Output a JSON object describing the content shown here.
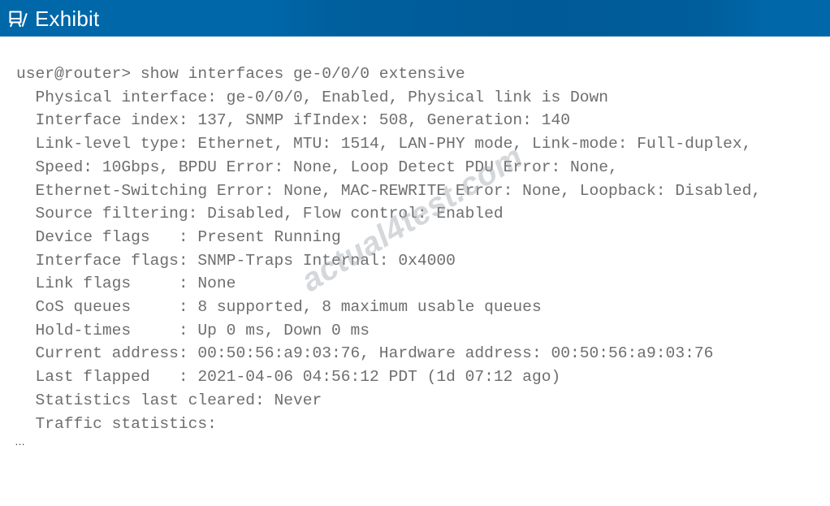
{
  "header": {
    "title": "Exhibit",
    "icon": "exhibit-easel-icon",
    "background_color": "#0067a8",
    "text_color": "#ffffff"
  },
  "terminal": {
    "prompt": "user@router>",
    "command": "show interfaces ge-0/0/0 extensive",
    "text_color": "#6e6e6e",
    "background_color": "#ffffff",
    "ellipsis": "…",
    "lines": [
      "user@router> show interfaces ge-0/0/0 extensive",
      "  Physical interface: ge-0/0/0, Enabled, Physical link is Down",
      "  Interface index: 137, SNMP ifIndex: 508, Generation: 140",
      "  Link-level type: Ethernet, MTU: 1514, LAN-PHY mode, Link-mode: Full-duplex,",
      "  Speed: 10Gbps, BPDU Error: None, Loop Detect PDU Error: None,",
      "  Ethernet-Switching Error: None, MAC-REWRITE Error: None, Loopback: Disabled,",
      "  Source filtering: Disabled, Flow control: Enabled",
      "  Device flags   : Present Running",
      "  Interface flags: SNMP-Traps Internal: 0x4000",
      "  Link flags     : None",
      "  CoS queues     : 8 supported, 8 maximum usable queues",
      "  Hold-times     : Up 0 ms, Down 0 ms",
      "  Current address: 00:50:56:a9:03:76, Hardware address: 00:50:56:a9:03:76",
      "  Last flapped   : 2021-04-06 04:56:12 PDT (1d 07:12 ago)",
      "  Statistics last cleared: Never",
      "  Traffic statistics:"
    ],
    "fields": {
      "physical_interface": "ge-0/0/0",
      "admin_state": "Enabled",
      "physical_link": "Down",
      "interface_index": "137",
      "snmp_ifindex": "508",
      "generation": "140",
      "link_level_type": "Ethernet",
      "mtu": "1514",
      "phy_mode": "LAN-PHY mode",
      "link_mode": "Full-duplex",
      "speed": "10Gbps",
      "bpdu_error": "None",
      "loop_detect_pdu_error": "None",
      "ethernet_switching_error": "None",
      "mac_rewrite_error": "None",
      "loopback": "Disabled",
      "source_filtering": "Disabled",
      "flow_control": "Enabled",
      "device_flags": "Present Running",
      "interface_flags": "SNMP-Traps Internal: 0x4000",
      "link_flags": "None",
      "cos_queues": "8 supported, 8 maximum usable queues",
      "hold_times": "Up 0 ms, Down 0 ms",
      "current_address": "00:50:56:a9:03:76",
      "hardware_address": "00:50:56:a9:03:76",
      "last_flapped": "2021-04-06 04:56:12 PDT (1d 07:12 ago)",
      "statistics_last_cleared": "Never",
      "traffic_statistics": ""
    }
  },
  "watermark": {
    "text": "actual4test.com",
    "color": "#a0a8b0"
  }
}
